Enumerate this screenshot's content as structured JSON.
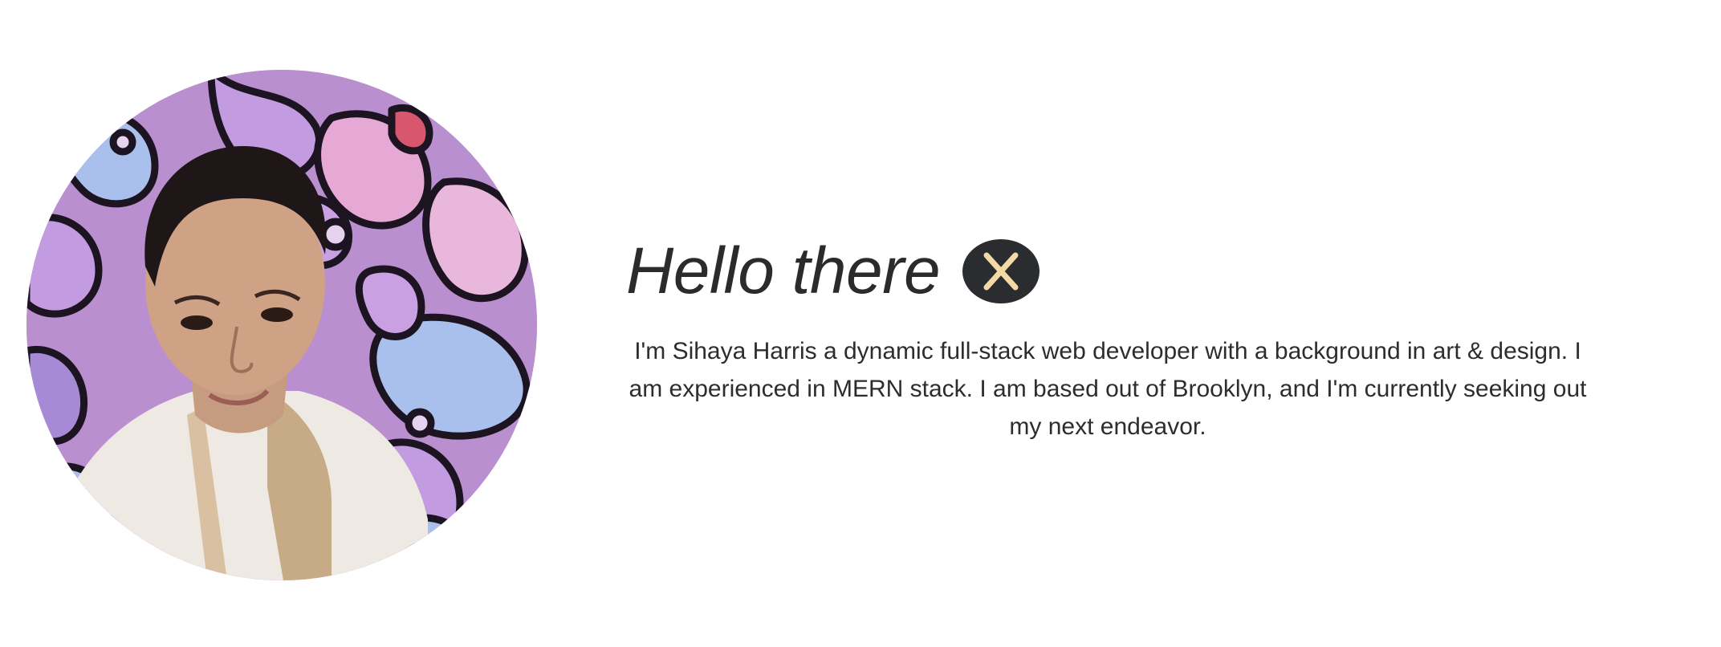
{
  "profile": {
    "photo_alt": "Portrait of Sihaya Harris in front of a purple floral mural",
    "colors": {
      "mural_base": "#b98fd0",
      "mural_pink": "#e6a9d6",
      "mural_blue": "#a9c0ec",
      "mural_line": "#1c1420",
      "accent_red": "#d9566f"
    }
  },
  "intro": {
    "greeting": "Hello there",
    "badge_icon": "close-x-icon",
    "badge_colors": {
      "background": "#2a2c2f",
      "glyph": "#f3d9a6"
    },
    "bio": "I'm Sihaya Harris a dynamic full-stack web developer with a background in art & design. I am experienced in MERN stack. I am based out of Brooklyn, and I'm currently seeking out my next endeavor."
  }
}
